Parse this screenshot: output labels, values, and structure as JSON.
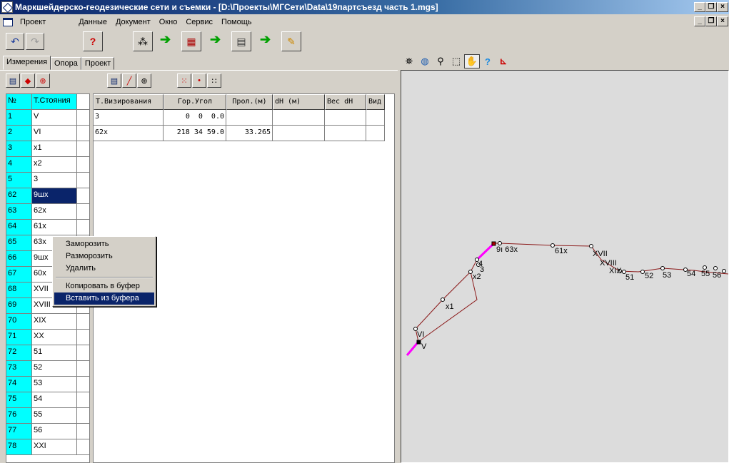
{
  "window": {
    "title": "Маркшейдерско-геодезические сети и съемки - [D:\\Проекты\\МГСети\\Data\\19партсъезд часть 1.mgs]"
  },
  "menu": [
    "Проект",
    "Данные",
    "Документ",
    "Окно",
    "Сервис",
    "Помощь"
  ],
  "tabs": [
    "Измерения",
    "Опора",
    "Проект"
  ],
  "stations_grid": {
    "headers": [
      "№",
      "Т.Стояния"
    ],
    "rows": [
      [
        "1",
        "V"
      ],
      [
        "2",
        "VI"
      ],
      [
        "3",
        "x1"
      ],
      [
        "4",
        "x2"
      ],
      [
        "5",
        "3"
      ],
      [
        "62",
        "9шх"
      ],
      [
        "63",
        "62х"
      ],
      [
        "64",
        "61х"
      ],
      [
        "65",
        "63х"
      ],
      [
        "66",
        "9шх"
      ],
      [
        "67",
        "60х"
      ],
      [
        "68",
        "XVII"
      ],
      [
        "69",
        "XVIII"
      ],
      [
        "70",
        "XIX"
      ],
      [
        "71",
        "XX"
      ],
      [
        "72",
        "51"
      ],
      [
        "73",
        "52"
      ],
      [
        "74",
        "53"
      ],
      [
        "75",
        "54"
      ],
      [
        "76",
        "55"
      ],
      [
        "77",
        "56"
      ],
      [
        "78",
        "XXI"
      ]
    ],
    "selected_index": 5
  },
  "measure_grid": {
    "headers": [
      "Т.Визирования",
      "Гор.Угол",
      "Прол.(м)",
      "dH (м)",
      "Вес dH",
      "Вид"
    ],
    "rows": [
      [
        "3",
        "0  0  0.0",
        "",
        "",
        "",
        ""
      ],
      [
        "62х",
        "218 34 59.0",
        "33.265",
        "",
        "",
        ""
      ]
    ]
  },
  "context_menu": {
    "items": [
      "Заморозить",
      "Разморозить",
      "Удалить",
      "Копировать в буфер",
      "Вставить из буфера"
    ],
    "highlighted_index": 4
  },
  "map_labels": {
    "VI": "VI",
    "V": "V",
    "x1": "x1",
    "x2": "x2",
    "p3": "3",
    "p4": "4",
    "p9_63": "9ı 63x",
    "x61": "61x",
    "xvii": "XVII",
    "xviii": "XVIII",
    "xix": "XIX",
    "p51": "51",
    "p52": "52",
    "p53": "53",
    "p54": "54",
    "p55": "55",
    "p56": "56"
  },
  "colors": {
    "cyan": "#00ffff",
    "selection": "#0a246a",
    "traverse": "#8b1a1a",
    "highlight": "#ff00ff"
  },
  "icons": [
    "undo-icon",
    "redo-icon",
    "help-book-icon",
    "magic-wand-icon",
    "arrow-right-icon",
    "calc-grid-icon",
    "calculator-icon",
    "pencil-icon",
    "edit-table-icon",
    "point-icon",
    "zoom-icon",
    "line-icon",
    "pan-hand-icon",
    "help-icon",
    "axes-icon"
  ]
}
